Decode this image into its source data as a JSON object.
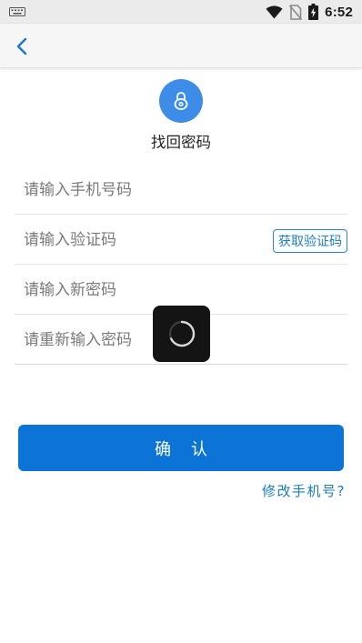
{
  "status_bar": {
    "time": "6:52",
    "icons": [
      "keyboard-icon",
      "wifi-icon",
      "no-sim-icon",
      "battery-charging-icon"
    ]
  },
  "app_bar": {
    "back_icon": "chevron-left-icon"
  },
  "header": {
    "icon": "lock-icon",
    "title": "找回密码"
  },
  "form": {
    "phone_placeholder": "请输入手机号码",
    "code_placeholder": "请输入验证码",
    "get_code_label": "获取验证码",
    "new_password_placeholder": "请输入新密码",
    "confirm_password_placeholder": "请重新输入密码"
  },
  "loading": {
    "icon": "spinner-icon"
  },
  "actions": {
    "confirm_label": "确认",
    "change_phone_label": "修改手机号?"
  },
  "colors": {
    "accent": "#0c74d6",
    "icon_circle": "#3c8ce8",
    "link": "#1a7bbf"
  }
}
